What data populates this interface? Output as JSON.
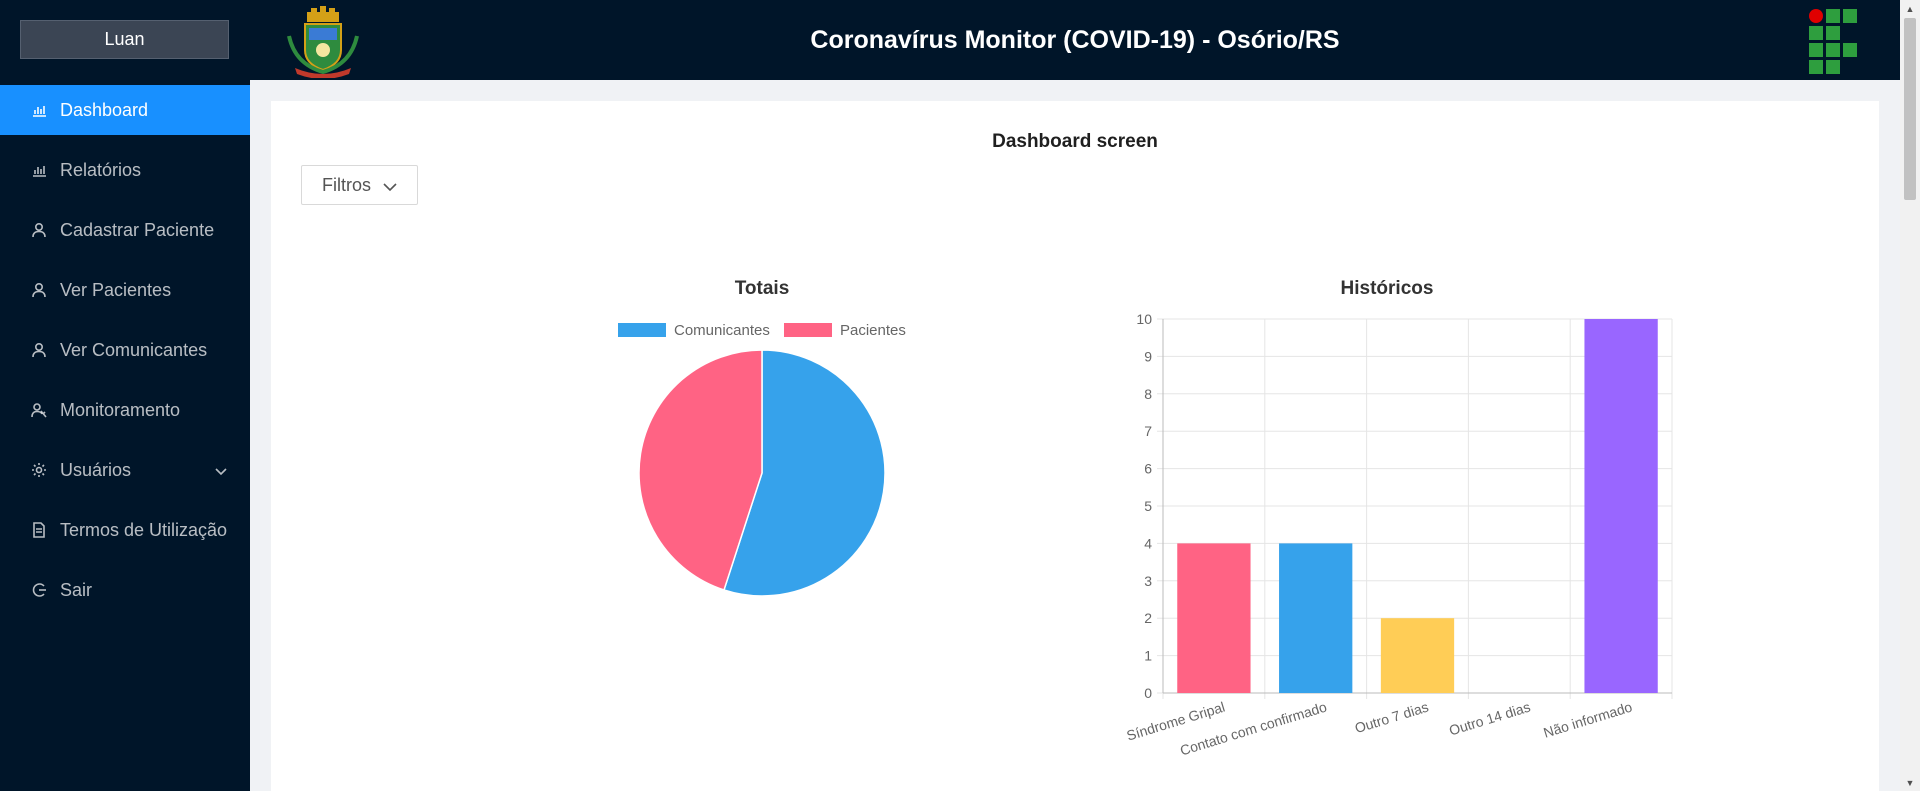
{
  "user": {
    "name": "Luan"
  },
  "sidebar": {
    "items": [
      {
        "label": "Dashboard",
        "icon": "bar-chart-icon",
        "active": true
      },
      {
        "label": "Relatórios",
        "icon": "bar-chart-icon",
        "active": false
      },
      {
        "label": "Cadastrar Paciente",
        "icon": "user-icon",
        "active": false
      },
      {
        "label": "Ver Pacientes",
        "icon": "user-icon",
        "active": false
      },
      {
        "label": "Ver Comunicantes",
        "icon": "user-icon",
        "active": false
      },
      {
        "label": "Monitoramento",
        "icon": "users-icon",
        "active": false
      },
      {
        "label": "Usuários",
        "icon": "gear-icon",
        "active": false,
        "expandable": true
      },
      {
        "label": "Termos de Utilização",
        "icon": "document-icon",
        "active": false
      },
      {
        "label": "Sair",
        "icon": "logout-icon",
        "active": false
      }
    ]
  },
  "header": {
    "title": "Coronavírus Monitor (COVID-19) - Osório/RS"
  },
  "main": {
    "title": "Dashboard screen",
    "filter_label": "Filtros"
  },
  "colors": {
    "sidebar_bg": "#001529",
    "active": "#1890ff",
    "pink": "#ff6384",
    "blue": "#36a2eb",
    "yellow": "#ffcd56",
    "purple": "#9966ff"
  },
  "chart_data": [
    {
      "type": "pie",
      "title": "Totais",
      "labels": [
        "Comunicantes",
        "Pacientes"
      ],
      "values": [
        55,
        45
      ],
      "colors": [
        "#36a2eb",
        "#ff6384"
      ],
      "legend": "top"
    },
    {
      "type": "bar",
      "title": "Históricos",
      "categories": [
        "Síndrome Gripal",
        "Contato com confirmado",
        "Outro 7 dias",
        "Outro 14 dias",
        "Não informado"
      ],
      "values": [
        4,
        4,
        2,
        0,
        10
      ],
      "colors": [
        "#ff6384",
        "#36a2eb",
        "#ffcd56",
        "#4bc0c0",
        "#9966ff"
      ],
      "ylim": [
        0,
        10
      ],
      "yticks": [
        "0",
        "1",
        "2",
        "3",
        "4",
        "5",
        "6",
        "7",
        "8",
        "9",
        "10"
      ],
      "grid": true
    }
  ]
}
